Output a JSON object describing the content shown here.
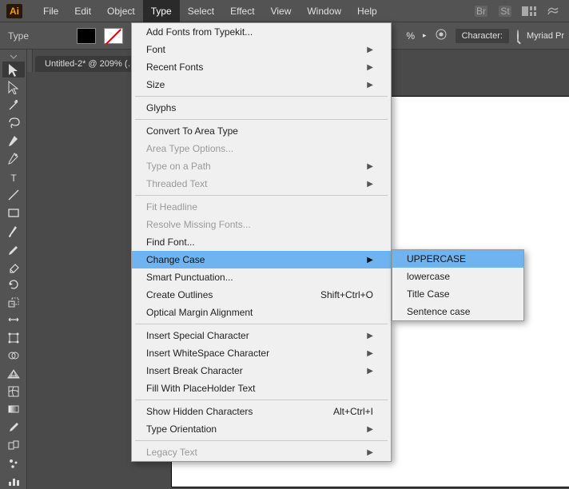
{
  "menubar": {
    "items": [
      "File",
      "Edit",
      "Object",
      "Type",
      "Select",
      "Effect",
      "View",
      "Window",
      "Help"
    ],
    "active_index": 3
  },
  "options_bar": {
    "tool_label": "Type",
    "opacity_suffix": "%",
    "char_panel": "Character:",
    "font_family": "Myriad Pr"
  },
  "document": {
    "tab_title": "Untitled-2* @ 209% (…"
  },
  "type_menu": {
    "items": [
      {
        "label": "Add Fonts from Typekit...",
        "enabled": true
      },
      {
        "label": "Font",
        "enabled": true,
        "sub": true
      },
      {
        "label": "Recent Fonts",
        "enabled": true,
        "sub": true
      },
      {
        "label": "Size",
        "enabled": true,
        "sub": true
      },
      {
        "sep": true
      },
      {
        "label": "Glyphs",
        "enabled": true
      },
      {
        "sep": true
      },
      {
        "label": "Convert To Area Type",
        "enabled": true
      },
      {
        "label": "Area Type Options...",
        "enabled": false
      },
      {
        "label": "Type on a Path",
        "enabled": false,
        "sub": true
      },
      {
        "label": "Threaded Text",
        "enabled": false,
        "sub": true
      },
      {
        "sep": true
      },
      {
        "label": "Fit Headline",
        "enabled": false
      },
      {
        "label": "Resolve Missing Fonts...",
        "enabled": false
      },
      {
        "label": "Find Font...",
        "enabled": true
      },
      {
        "label": "Change Case",
        "enabled": true,
        "sub": true,
        "highlight": true
      },
      {
        "label": "Smart Punctuation...",
        "enabled": true
      },
      {
        "label": "Create Outlines",
        "enabled": true,
        "shortcut": "Shift+Ctrl+O"
      },
      {
        "label": "Optical Margin Alignment",
        "enabled": true
      },
      {
        "sep": true
      },
      {
        "label": "Insert Special Character",
        "enabled": true,
        "sub": true
      },
      {
        "label": "Insert WhiteSpace Character",
        "enabled": true,
        "sub": true
      },
      {
        "label": "Insert Break Character",
        "enabled": true,
        "sub": true
      },
      {
        "label": "Fill With PlaceHolder Text",
        "enabled": true
      },
      {
        "sep": true
      },
      {
        "label": "Show Hidden Characters",
        "enabled": true,
        "shortcut": "Alt+Ctrl+I"
      },
      {
        "label": "Type Orientation",
        "enabled": true,
        "sub": true
      },
      {
        "sep": true
      },
      {
        "label": "Legacy Text",
        "enabled": false,
        "sub": true
      }
    ]
  },
  "change_case_submenu": {
    "items": [
      {
        "label": "UPPERCASE",
        "highlight": true
      },
      {
        "label": "lowercase"
      },
      {
        "label": "Title Case"
      },
      {
        "label": "Sentence case"
      }
    ]
  },
  "tools": [
    "selection",
    "direct-selection",
    "magic-wand",
    "lasso",
    "pen",
    "curvature-pen",
    "type",
    "line",
    "rectangle",
    "paintbrush",
    "pencil",
    "eraser",
    "rotate",
    "scale",
    "width",
    "free-transform",
    "shape-builder",
    "perspective-grid",
    "mesh",
    "gradient",
    "eyedropper",
    "blend",
    "symbol-sprayer",
    "column-graph"
  ]
}
